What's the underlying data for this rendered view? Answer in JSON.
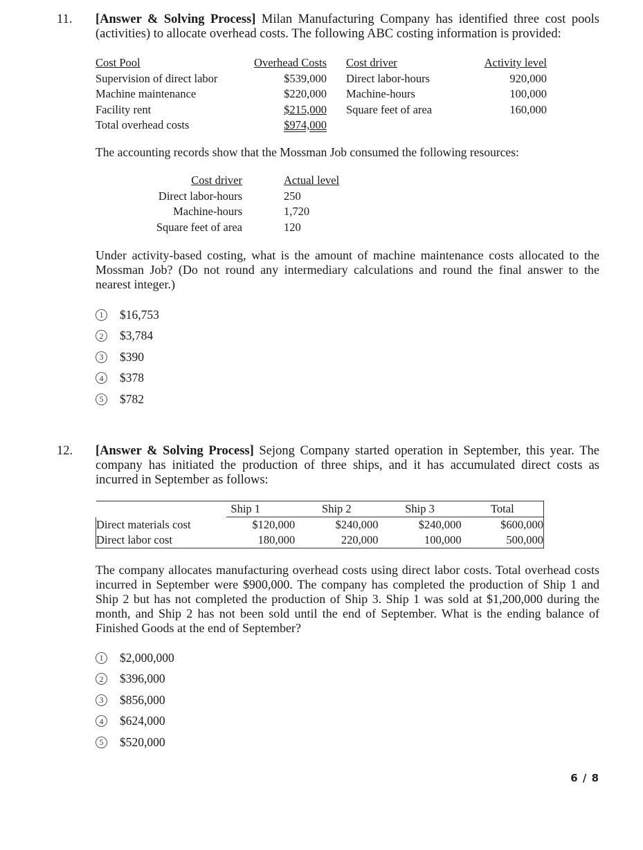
{
  "page": {
    "number_label": "6 / 8"
  },
  "q11": {
    "number": "11.",
    "tag": "[Answer & Solving Process]",
    "intro": " Milan Manufacturing Company has identified three cost pools (activities) to allocate overhead costs. The following ABC costing information is provided:",
    "abc_table": {
      "headers": [
        "Cost Pool",
        "Overhead Costs",
        "Cost driver",
        "Activity level"
      ],
      "rows": [
        {
          "pool": "Supervision of direct labor",
          "cost": "$539,000",
          "driver": "Direct labor-hours",
          "level": "920,000"
        },
        {
          "pool": "Machine maintenance",
          "cost": "$220,000",
          "driver": "Machine-hours",
          "level": "100,000"
        },
        {
          "pool": "Facility rent",
          "cost": "$215,000",
          "driver": "Square feet of area",
          "level": "160,000"
        },
        {
          "pool": "Total overhead costs",
          "cost": "$974,000",
          "driver": "",
          "level": ""
        }
      ]
    },
    "records_text": "The accounting records show that the Mossman Job consumed the following resources:",
    "resource_table": {
      "headers": [
        "Cost driver",
        "Actual level"
      ],
      "rows": [
        {
          "driver": "Direct labor-hours",
          "level": "250"
        },
        {
          "driver": "Machine-hours",
          "level": "1,720"
        },
        {
          "driver": "Square feet of area",
          "level": "120"
        }
      ]
    },
    "question": "Under activity-based costing, what is the amount of machine maintenance costs allocated to the Mossman Job? (Do not round any intermediary calculations and round the final answer to the nearest integer.)",
    "options": [
      {
        "mark": "1",
        "text": "$16,753"
      },
      {
        "mark": "2",
        "text": "$3,784"
      },
      {
        "mark": "3",
        "text": "$390"
      },
      {
        "mark": "4",
        "text": "$378"
      },
      {
        "mark": "5",
        "text": "$782"
      }
    ]
  },
  "q12": {
    "number": "12.",
    "tag": "[Answer & Solving Process]",
    "intro": " Sejong Company started operation in September, this year. The company has initiated the production of three ships, and it has accumulated direct costs as incurred in September as follows:",
    "ship_table": {
      "headers": [
        "",
        "Ship 1",
        "Ship 2",
        "Ship 3",
        "Total"
      ],
      "rows": [
        {
          "label": "Direct materials cost",
          "ship1": "$120,000",
          "ship2": "$240,000",
          "ship3": "$240,000",
          "total": "$600,000"
        },
        {
          "label": "Direct labor cost",
          "ship1": "180,000",
          "ship2": "220,000",
          "ship3": "100,000",
          "total": "500,000"
        }
      ]
    },
    "question": "The company allocates manufacturing overhead costs using direct labor costs. Total overhead costs incurred in September were $900,000. The company has completed the production of Ship 1 and Ship 2 but has not completed the production of Ship 3. Ship 1 was sold at $1,200,000 during the month, and Ship 2 has not been sold until the end of September. What is the ending balance of Finished Goods at the end of September?",
    "options": [
      {
        "mark": "1",
        "text": "$2,000,000"
      },
      {
        "mark": "2",
        "text": "$396,000"
      },
      {
        "mark": "3",
        "text": "$856,000"
      },
      {
        "mark": "4",
        "text": "$624,000"
      },
      {
        "mark": "5",
        "text": "$520,000"
      }
    ]
  }
}
